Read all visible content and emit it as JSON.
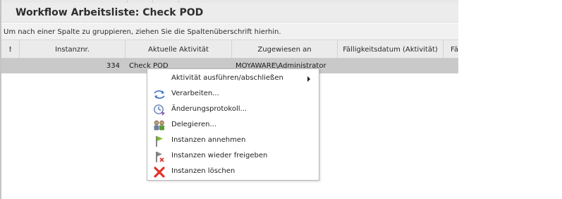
{
  "window": {
    "title": "Workflow Arbeitsliste: Check POD"
  },
  "group_panel": {
    "hint": "Um nach einer Spalte zu gruppieren, ziehen Sie die Spaltenüberschrift hierhin."
  },
  "grid": {
    "columns": [
      "!",
      "Instanznr.",
      "Aktuelle Aktivität",
      "Zugewiesen an",
      "Fälligkeitsdatum (Aktivität)",
      "Fä"
    ],
    "rows": [
      {
        "instance_number": "334",
        "current_activity": "Check POD",
        "assigned_to": "MOYAWARE\\Administrator"
      }
    ]
  },
  "context_menu": {
    "items": [
      {
        "label": "Aktivität ausführen/abschließen",
        "icon": "none",
        "has_submenu": true
      },
      {
        "label": "Verarbeiten...",
        "icon": "process-icon"
      },
      {
        "label": "Änderungsprotokoll...",
        "icon": "history-clock-icon"
      },
      {
        "label": "Delegieren...",
        "icon": "delegate-users-icon"
      },
      {
        "label": "Instanzen annehmen",
        "icon": "green-flag-icon"
      },
      {
        "label": "Instanzen wieder freigeben",
        "icon": "flag-release-icon"
      },
      {
        "label": "Instanzen löschen",
        "icon": "red-x-delete-icon"
      }
    ]
  },
  "colors": {
    "selected_row": "#c9c9c9",
    "header_bg": "#ebebeb",
    "title_bg": "#ececec",
    "delete_red": "#e0332b",
    "flag_green": "#7cbf2a"
  }
}
